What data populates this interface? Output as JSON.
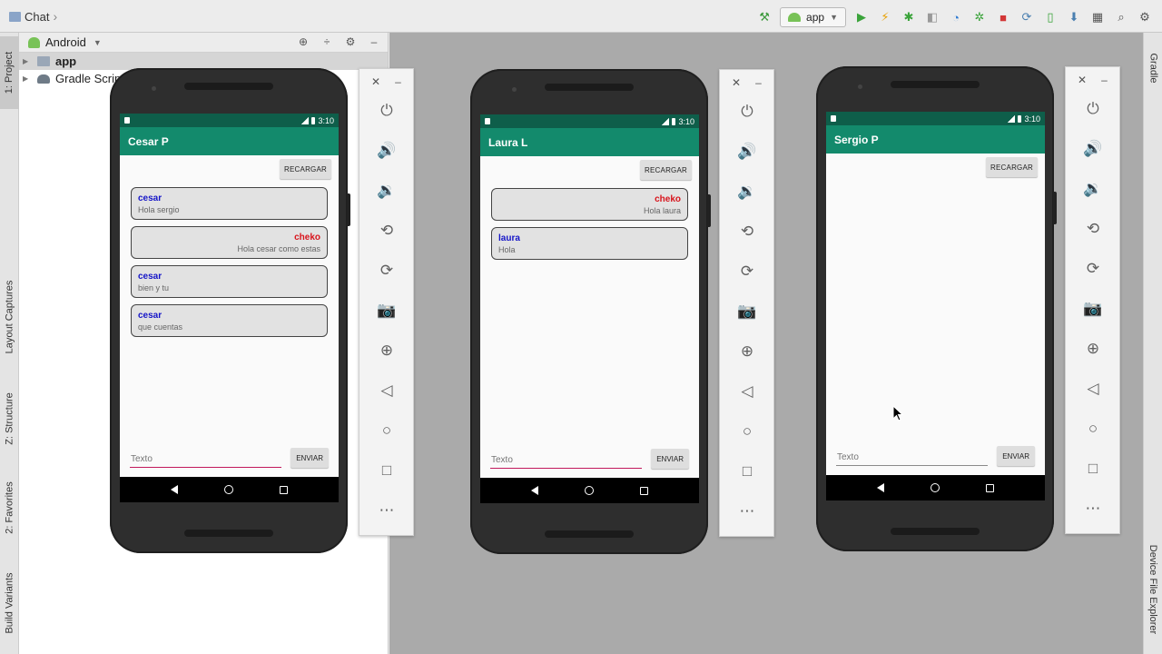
{
  "topbar": {
    "project_name": "Chat",
    "run_config": "app"
  },
  "left_tabs": {
    "project": "1: Project",
    "layout_captures": "Layout Captures",
    "structure": "Z: Structure",
    "favorites": "2: Favorites",
    "build_variants": "Build Variants"
  },
  "right_tabs": {
    "gradle": "Gradle",
    "device_file_explorer": "Device File Explorer"
  },
  "project_panel": {
    "view_mode": "Android",
    "tree": [
      {
        "label": "app"
      },
      {
        "label": "Gradle Scripts"
      }
    ]
  },
  "devices": [
    {
      "status_time": "3:10",
      "title": "Cesar P",
      "reload_label": "RECARGAR",
      "messages": [
        {
          "author": "cesar",
          "text": "Hola sergio",
          "side": "left",
          "color": "#1515c8"
        },
        {
          "author": "cheko",
          "text": "Hola cesar como estas",
          "side": "right",
          "color": "#d8141c"
        },
        {
          "author": "cesar",
          "text": "bien y tu",
          "side": "left",
          "color": "#1515c8"
        },
        {
          "author": "cesar",
          "text": "que cuentas",
          "side": "left",
          "color": "#1515c8"
        }
      ],
      "input_placeholder": "Texto",
      "send_label": "ENVIAR"
    },
    {
      "status_time": "3:10",
      "title": "Laura L",
      "reload_label": "RECARGAR",
      "messages": [
        {
          "author": "cheko",
          "text": "Hola laura",
          "side": "right",
          "color": "#d8141c"
        },
        {
          "author": "laura",
          "text": "Hola",
          "side": "left",
          "color": "#1515c8"
        }
      ],
      "input_placeholder": "Texto",
      "send_label": "ENVIAR"
    },
    {
      "status_time": "3:10",
      "title": "Sergio P",
      "reload_label": "RECARGAR",
      "messages": [],
      "input_placeholder": "Texto",
      "send_label": "ENVIAR"
    }
  ],
  "emulator_controls": [
    "power-icon",
    "volume-up-icon",
    "volume-down-icon",
    "rotate-left-icon",
    "rotate-right-icon",
    "camera-icon",
    "zoom-icon",
    "back-icon",
    "home-icon",
    "overview-icon",
    "more-icon"
  ],
  "colors": {
    "app_bar": "#138a6c",
    "status_bar": "#0e5e4a",
    "author_self": "#1515c8",
    "author_other": "#d8141c",
    "input_focus": "#c2185b"
  }
}
